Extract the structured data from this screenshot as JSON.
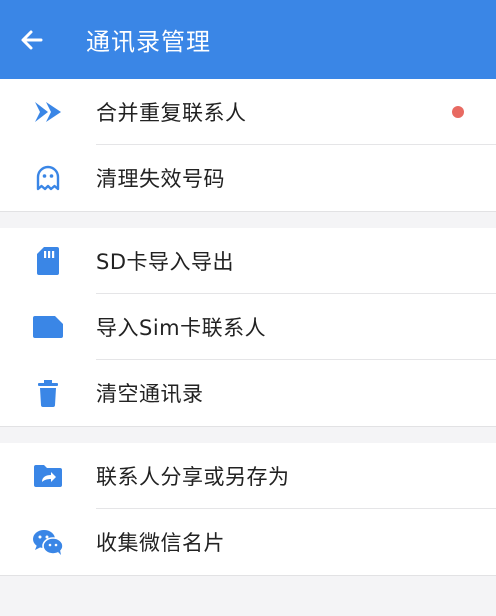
{
  "colors": {
    "header": "#3a86e6",
    "icon": "#3a86e6",
    "badge": "#e86a62"
  },
  "header": {
    "title": "通讯录管理",
    "back_icon": "back-arrow-icon"
  },
  "groups": [
    {
      "items": [
        {
          "label": "合并重复联系人",
          "icon": "merge-arrows-icon",
          "badge": true
        },
        {
          "label": "清理失效号码",
          "icon": "ghost-icon",
          "badge": false
        }
      ]
    },
    {
      "items": [
        {
          "label": "SD卡导入导出",
          "icon": "sd-card-icon"
        },
        {
          "label": "导入Sim卡联系人",
          "icon": "sim-card-icon"
        },
        {
          "label": "清空通讯录",
          "icon": "trash-icon"
        }
      ]
    },
    {
      "items": [
        {
          "label": "联系人分享或另存为",
          "icon": "folder-share-icon"
        },
        {
          "label": "收集微信名片",
          "icon": "wechat-icon"
        }
      ]
    }
  ]
}
